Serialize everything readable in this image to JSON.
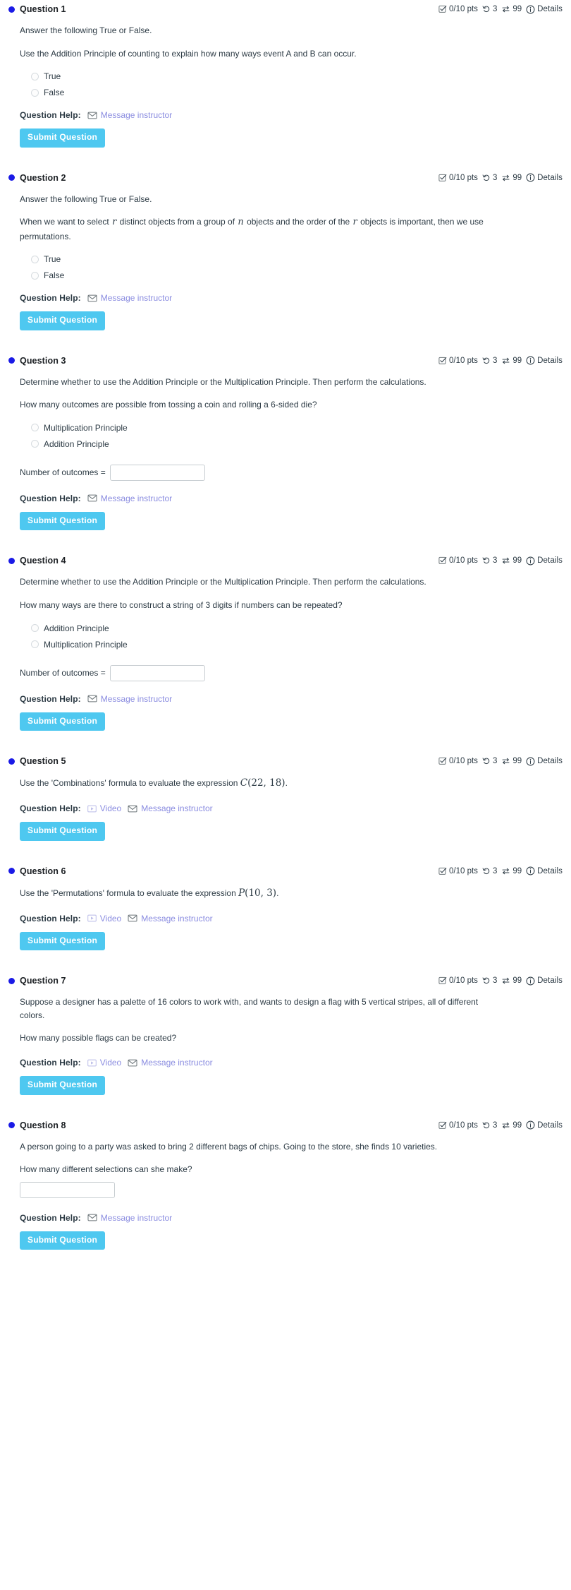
{
  "meta": {
    "score_text": "0/10 pts",
    "attempts": "3",
    "tries": "99",
    "details_label": "Details",
    "accent_blue": "#1a1ae6",
    "submit_bg": "#4ec8f0",
    "link_color": "#8a8ce0"
  },
  "labels": {
    "question_help": "Question Help:",
    "message_instructor": "Message instructor",
    "video": "Video",
    "submit": "Submit Question",
    "number_of_outcomes": "Number of outcomes ="
  },
  "questions": [
    {
      "title": "Question 1",
      "paragraphs": [
        "Answer the following True or False.",
        "Use the Addition Principle of counting to explain how many ways event A and B can occur."
      ],
      "options": [
        "True",
        "False"
      ],
      "has_video": false,
      "has_outcome_field": false,
      "has_answer_box": false
    },
    {
      "title": "Question 2",
      "paragraphs": [
        "Answer the following True or False.",
        "When we want to select  r distinct objects from a group of n objects and the order of the r objects is important, then we use permutations."
      ],
      "options": [
        "True",
        "False"
      ],
      "has_video": false,
      "has_outcome_field": false,
      "has_answer_box": false
    },
    {
      "title": "Question 3",
      "paragraphs": [
        "Determine whether to use the Addition Principle or the Multiplication Principle. Then perform the calculations.",
        "How many outcomes are possible from tossing a coin and rolling a 6-sided die?"
      ],
      "options": [
        "Multiplication Principle",
        "Addition Principle"
      ],
      "has_video": false,
      "has_outcome_field": true,
      "has_answer_box": false
    },
    {
      "title": "Question 4",
      "paragraphs": [
        "Determine whether to use the Addition Principle or the Multiplication Principle. Then perform the calculations.",
        "How many ways are there to construct a string of 3 digits if numbers can be repeated?"
      ],
      "options": [
        "Addition Principle",
        "Multiplication Principle"
      ],
      "has_video": false,
      "has_outcome_field": true,
      "has_answer_box": false
    },
    {
      "title": "Question 5",
      "paragraphs": [
        "Use the 'Combinations' formula to evaluate the expression C(22, 18)."
      ],
      "options": [],
      "has_video": true,
      "has_outcome_field": false,
      "has_answer_box": false
    },
    {
      "title": "Question 6",
      "paragraphs": [
        "Use the 'Permutations' formula to evaluate the expression P(10, 3)."
      ],
      "options": [],
      "has_video": true,
      "has_outcome_field": false,
      "has_answer_box": false
    },
    {
      "title": "Question 7",
      "paragraphs": [
        "Suppose a designer has a palette of 16 colors to work with, and wants to design a flag with 5 vertical stripes, all of different colors.",
        "How many possible flags can be created?"
      ],
      "options": [],
      "has_video": true,
      "has_outcome_field": false,
      "has_answer_box": false
    },
    {
      "title": "Question 8",
      "paragraphs": [
        "A person going to a party was asked to bring 2 different bags of chips. Going to the store, she finds 10 varieties.",
        "How many different selections can she make?"
      ],
      "options": [],
      "has_video": false,
      "has_outcome_field": false,
      "has_answer_box": true
    }
  ]
}
